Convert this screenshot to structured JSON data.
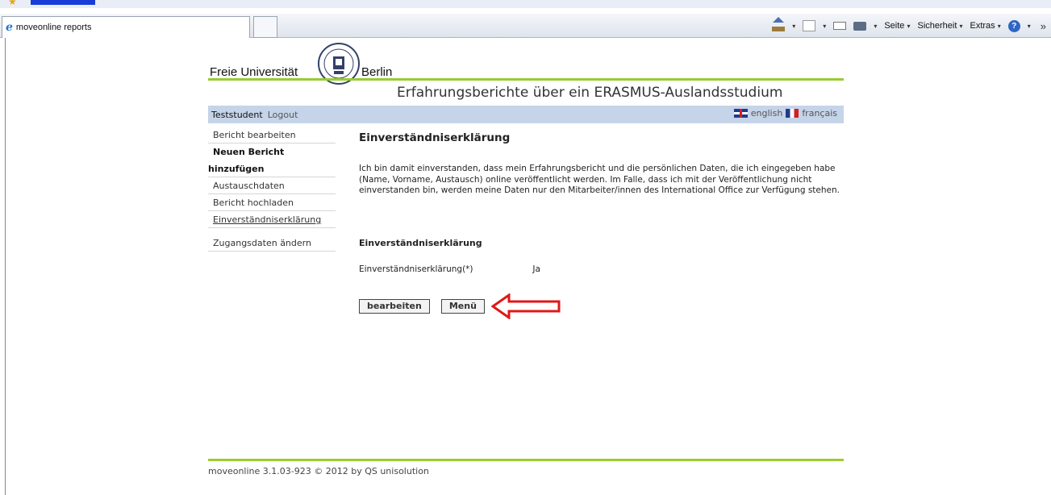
{
  "browser": {
    "tab_title": "moveonline reports",
    "menu_seite": "Seite",
    "menu_sicherheit": "Sicherheit",
    "menu_extras": "Extras"
  },
  "header": {
    "logo_left": "Freie Universität",
    "logo_right": "Berlin",
    "title": "Erfahrungsberichte über ein ERASMUS-Auslandsstudium"
  },
  "userbar": {
    "user": "Teststudent",
    "logout": "Logout",
    "lang_en": "english",
    "lang_fr": "français"
  },
  "sidebar": {
    "items": [
      "Bericht bearbeiten",
      "Neuen Bericht",
      "hinzufügen",
      "Austauschdaten",
      "Bericht hochladen",
      "Einverständniserklärung",
      "Zugangsdaten ändern"
    ]
  },
  "main": {
    "heading": "Einverständniserklärung",
    "paragraph": "Ich bin damit einverstanden, dass mein Erfahrungsbericht und die persönlichen Daten, die ich eingegeben habe (Name, Vorname, Austausch) online veröffentlicht werden. Im Falle, dass ich mit der Veröffentlichung nicht einverstanden bin, werden meine Daten nur den Mitarbeiter/innen des International Office zur Verfügung stehen.",
    "section_heading": "Einverständniserklärung",
    "field_label": "Einverständniserklärung(*)",
    "field_value": "Ja",
    "edit_button": "bearbeiten",
    "menu_button": "Menü"
  },
  "footer": {
    "text": "moveonline 3.1.03-923 © 2012 by QS unisolution"
  }
}
